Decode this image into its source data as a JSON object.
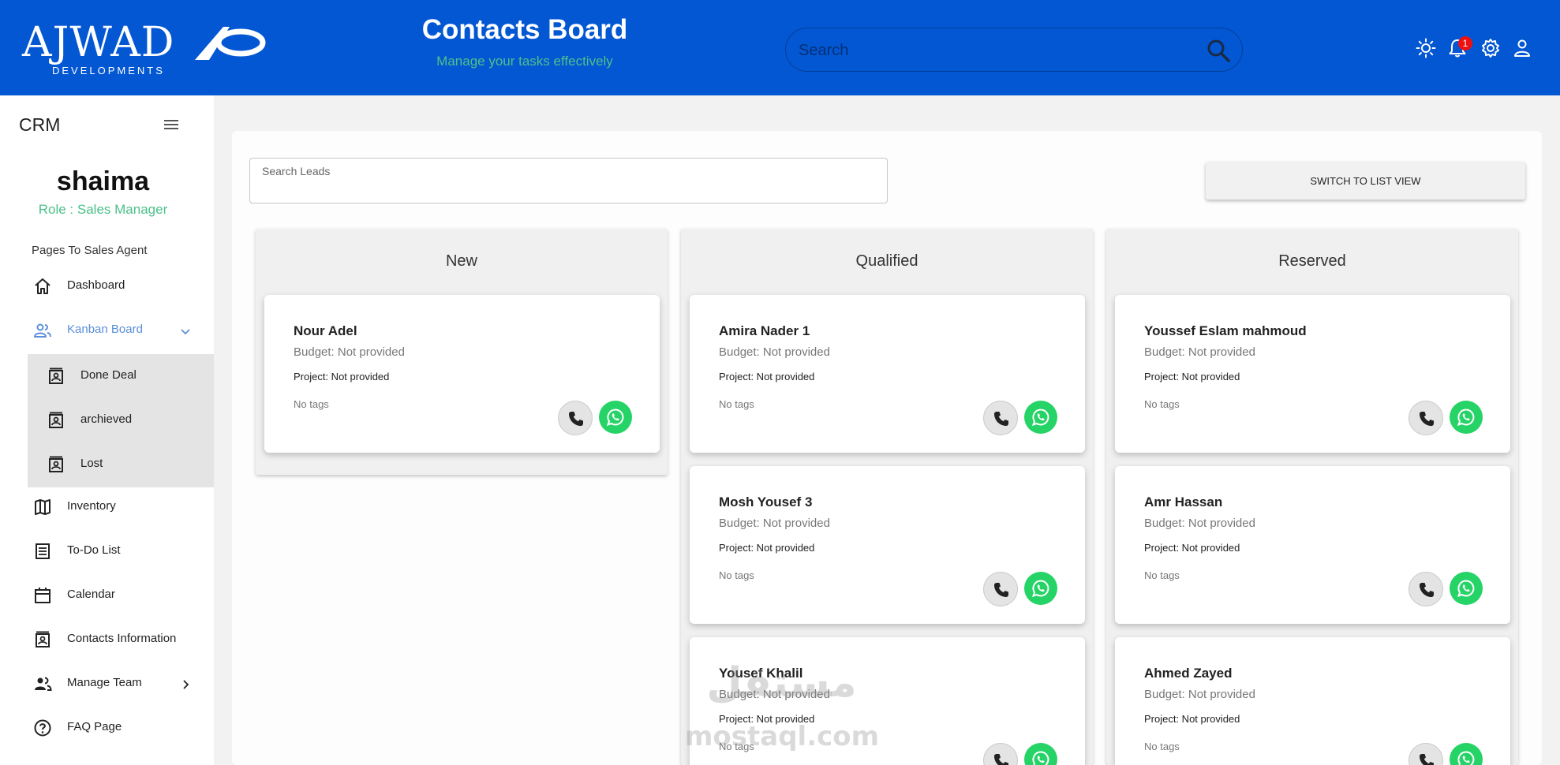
{
  "header": {
    "logo_main": "AJWAD",
    "logo_sub": "DEVELOPMENTS",
    "title": "Contacts Board",
    "subtitle": "Manage your tasks effectively",
    "search_placeholder": "Search",
    "notification_count": "1"
  },
  "sidebar": {
    "app_name": "CRM",
    "user_name": "shaima",
    "user_role": "Role : Sales Manager",
    "section_title": "Pages To Sales Agent",
    "items": [
      {
        "label": "Dashboard",
        "icon": "home-icon"
      },
      {
        "label": "Kanban Board",
        "icon": "people-icon"
      },
      {
        "label": "Inventory",
        "icon": "map-icon"
      },
      {
        "label": "To-Do List",
        "icon": "list-icon"
      },
      {
        "label": "Calendar",
        "icon": "calendar-icon"
      },
      {
        "label": "Contacts Information",
        "icon": "contact-icon"
      },
      {
        "label": "Manage Team",
        "icon": "team-icon"
      },
      {
        "label": "FAQ Page",
        "icon": "help-icon"
      }
    ],
    "subitems": [
      {
        "label": "Done Deal",
        "icon": "contact-icon"
      },
      {
        "label": "archieved",
        "icon": "contact-icon"
      },
      {
        "label": "Lost",
        "icon": "contact-icon"
      }
    ]
  },
  "board": {
    "search_label": "Search Leads",
    "switch_label": "SWITCH TO LIST VIEW",
    "columns": [
      {
        "title": "New",
        "cards": [
          {
            "name": "Nour Adel",
            "budget": "Budget: Not provided",
            "project": "Project: Not provided",
            "tags": "No tags"
          }
        ]
      },
      {
        "title": "Qualified",
        "cards": [
          {
            "name": "Amira Nader 1",
            "budget": "Budget: Not provided",
            "project": "Project: Not provided",
            "tags": "No tags"
          },
          {
            "name": "Mosh Yousef 3",
            "budget": "Budget: Not provided",
            "project": "Project: Not provided",
            "tags": "No tags"
          },
          {
            "name": "Yousef Khalil",
            "budget": "Budget: Not provided",
            "project": "Project: Not provided",
            "tags": "No tags"
          }
        ]
      },
      {
        "title": "Reserved",
        "cards": [
          {
            "name": "Youssef Eslam mahmoud",
            "budget": "Budget: Not provided",
            "project": "Project: Not provided",
            "tags": "No tags"
          },
          {
            "name": "Amr Hassan",
            "budget": "Budget: Not provided",
            "project": "Project: Not provided",
            "tags": "No tags"
          },
          {
            "name": "Ahmed Zayed",
            "budget": "Budget: Not provided",
            "project": "Project: Not provided",
            "tags": "No tags"
          }
        ]
      }
    ]
  },
  "watermark": {
    "arabic": "مستقل",
    "latin": "mostaql.com"
  },
  "colors": {
    "header_bg": "#0357d3",
    "accent_green": "#4cc18a",
    "whatsapp": "#25d366",
    "active_nav": "#5b8fd9"
  }
}
